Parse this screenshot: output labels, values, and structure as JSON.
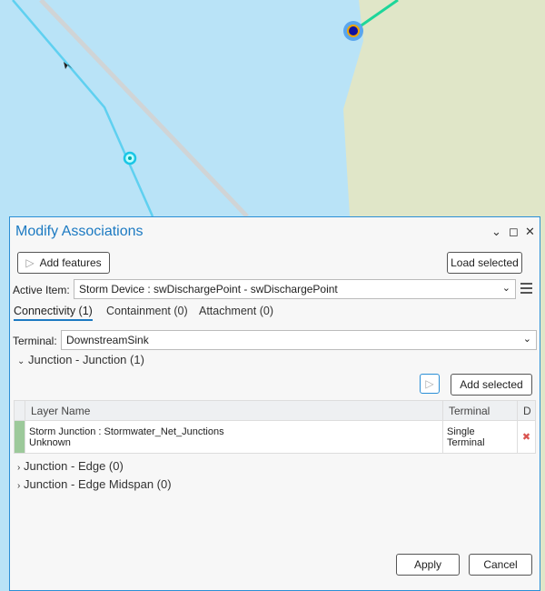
{
  "dialog": {
    "title": "Modify Associations",
    "add_features": "Add features",
    "load_selected": "Load selected",
    "active_item_label": "Active Item:",
    "active_item_value": "Storm Device : swDischargePoint - swDischargePoint",
    "tabs": [
      "Connectivity (1)",
      "Containment (0)",
      "Attachment (0)"
    ],
    "terminal_label": "Terminal:",
    "terminal_value": "DownstreamSink",
    "sections": [
      "Junction - Junction (1)",
      "Junction - Edge (0)",
      "Junction - Edge Midspan (0)"
    ],
    "add_selected": "Add selected",
    "table": {
      "headers": [
        "Layer Name",
        "Terminal",
        "D"
      ],
      "rows": [
        {
          "name": "Storm Junction : Stormwater_Net_Junctions",
          "sub": "Unknown",
          "terminal": "Single Terminal"
        }
      ]
    },
    "apply": "Apply",
    "cancel": "Cancel"
  },
  "colors": {
    "accent": "#1c7ac2",
    "water": "#b9e3f7",
    "land": "#e0e6c8",
    "row_marker": "#9cc99a",
    "delete": "#d9534f"
  }
}
